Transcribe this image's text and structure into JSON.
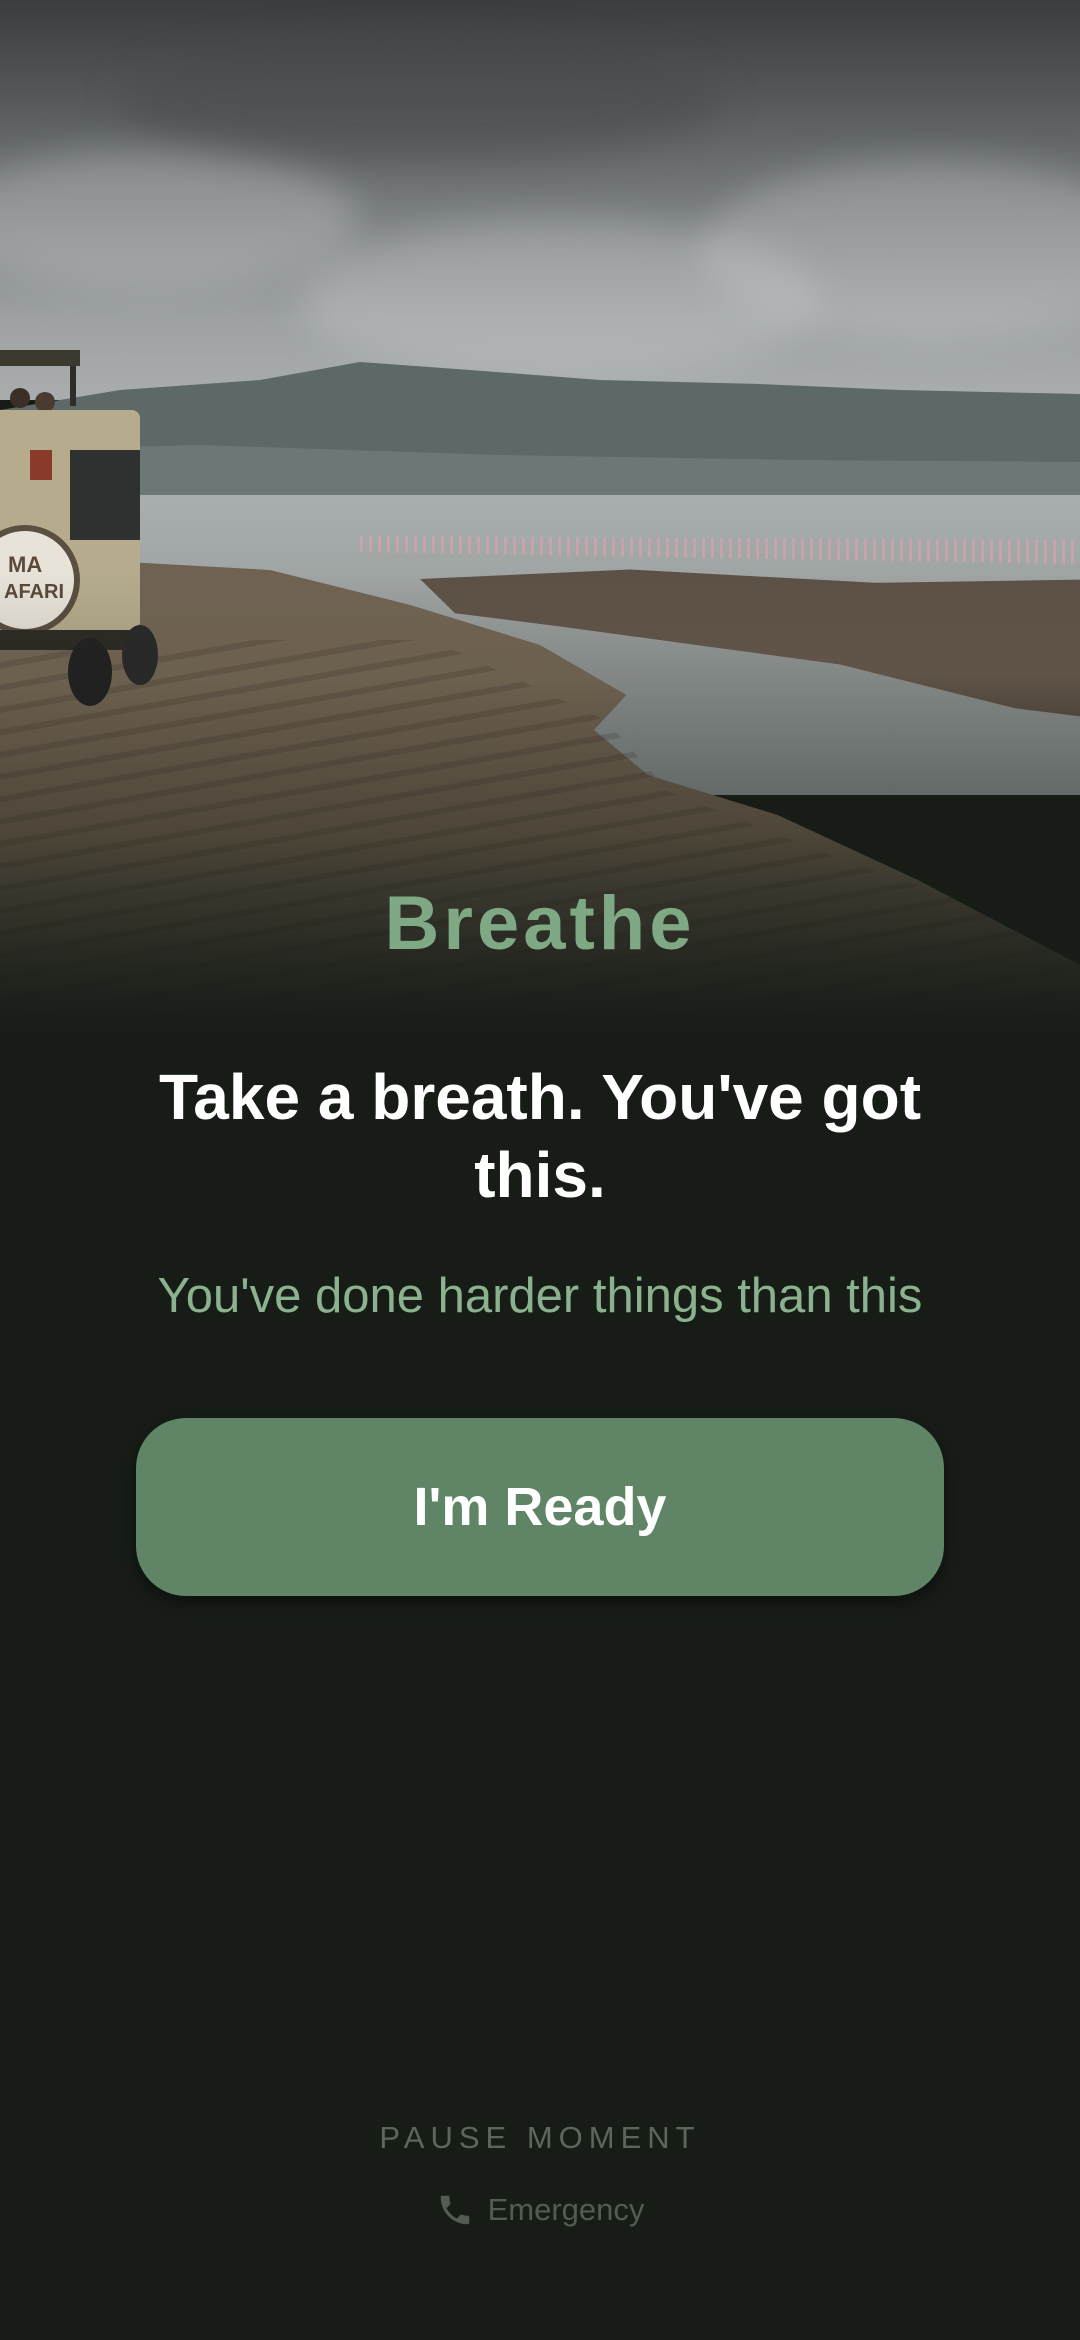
{
  "hero": {
    "image_description_icon": "landscape-photo"
  },
  "app": {
    "title": "Breathe"
  },
  "main": {
    "headline": "Take a breath. You've got this.",
    "subline": "You've done harder things than this",
    "ready_button_label": "I'm Ready"
  },
  "footer": {
    "label": "PAUSE MOMENT",
    "emergency_label": "Emergency",
    "emergency_icon": "phone-icon"
  },
  "colors": {
    "background": "#171c17",
    "accent": "#7fa985",
    "button": "#5f8466",
    "subtext": "#8bb28f",
    "muted": "#5d665d"
  }
}
